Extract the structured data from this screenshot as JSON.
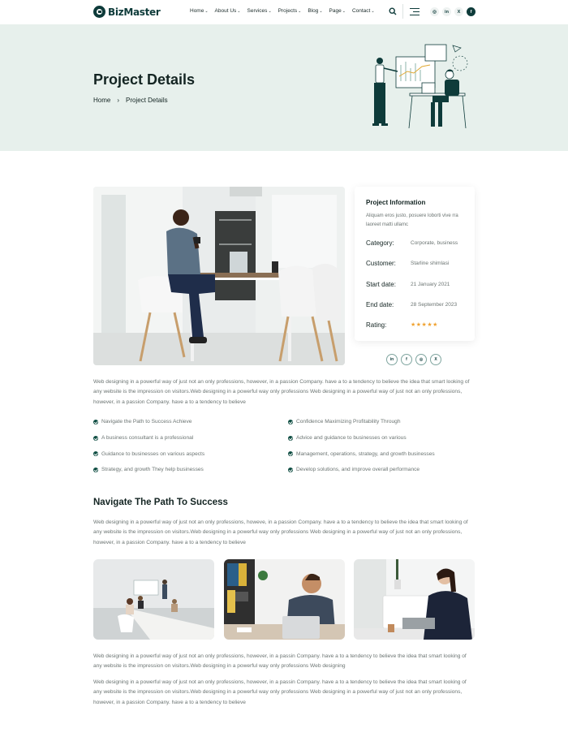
{
  "header": {
    "brand": "BizMaster",
    "nav": [
      {
        "label": "Home"
      },
      {
        "label": "About Us"
      },
      {
        "label": "Services"
      },
      {
        "label": "Projects"
      },
      {
        "label": "Blog"
      },
      {
        "label": "Page"
      },
      {
        "label": "Contact"
      }
    ],
    "socials": [
      "in",
      "in",
      "X",
      "f"
    ]
  },
  "hero": {
    "title": "Project Details",
    "breadcrumb_home": "Home",
    "breadcrumb_sep": "›",
    "breadcrumb_current": "Project Details"
  },
  "info": {
    "title": "Project Information",
    "desc": "Aliquam eros justo, posuere loborti vive rra laoreet matti ullamc",
    "rows": [
      {
        "label": "Category:",
        "value": "Corporate, business"
      },
      {
        "label": "Customer:",
        "value": "Starline shimlasi"
      },
      {
        "label": "Start date:",
        "value": "21 January 2021"
      },
      {
        "label": "End date:",
        "value": "28 September 2023"
      }
    ],
    "rating_label": "Rating:",
    "rating_stars": "★★★★★",
    "rating_value": 5
  },
  "share": [
    "in",
    "f",
    "◎",
    "X"
  ],
  "paragraphs": {
    "intro": "Web designing in a powerful way of just not an only professions, however, in a passion  Company. have a to a tendency to believe the idea that smart looking of any website is the  impression on visitors.Web designing in a powerful way only professions Web designing in a powerful way of just not an only professions, however, in a passion  Company.  have a to a tendency to believe",
    "section": "Web designing in a powerful way of just not an only professions, howeve, in a passion  Company.  have a to a tendency to believe the idea that smart looking of any website is the  impression on visitors.Web designing in a powerful way only professions Web designing in a powerful way of just not an only professions, however, in a passion  Company.  have a to a tendency to believe",
    "bottom1": "Web designing in a powerful way of just not an only professions, however, in a passin  Company.  have a to a tendency to believe the idea that smart looking of any website is the  impression on visitors.Web designing in a powerful way only professions Web designing",
    "bottom2": "Web designing in a powerful way of just not an only professions, however, in a passin  Company.  have a to a tendency to believe the idea that smart looking of any website is the  impression on visitors.Web designing in a powerful way only professions Web designing in a powerful way of just not an only professions, however, in a passion  Company.  have a to a tendency to believe"
  },
  "checklist_left": [
    "Navigate the Path to Success Achieve",
    "A business consultant is a professional",
    "Guidance to businesses on various aspects",
    "Strategy, and growth They help businesses"
  ],
  "checklist_right": [
    "Confidence Maximizing Profitability Through",
    "Advice and guidance to businesses on various",
    "Management, operations, strategy, and growth businesses",
    "Develop solutions, and improve overall performance"
  ],
  "section_title": "Navigate The Path To Success",
  "colors": {
    "brand": "#0e3b3a",
    "hero_bg": "#e7f0ec",
    "accent_star": "#f0a230"
  }
}
